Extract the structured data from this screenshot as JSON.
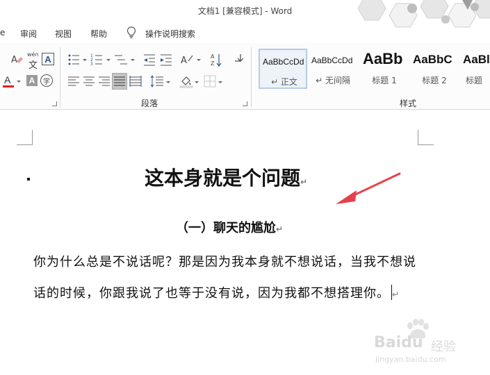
{
  "titlebar": {
    "title": "文档1 [兼容模式]  -  Word"
  },
  "menu": {
    "items": [
      "审阅",
      "视图",
      "帮助"
    ],
    "tell_me": "操作说明搜索"
  },
  "ribbon": {
    "font_group": {
      "phonetic_label": "wén",
      "phonetic_char": "文"
    },
    "paragraph_group": {
      "label": "段落"
    },
    "styles_group": {
      "label": "样式",
      "styles": [
        {
          "sample": "AaBbCcDd",
          "name": "↵ 正文"
        },
        {
          "sample": "AaBbCcDd",
          "name": "↵ 无间隔"
        },
        {
          "sample": "AaBb",
          "name": "标题 1"
        },
        {
          "sample": "AaBbC",
          "name": "标题 2"
        },
        {
          "sample": "AaBl",
          "name": "标题"
        }
      ]
    },
    "colors": {
      "font_color_red": "#e02020",
      "accent_blue": "#2b579a"
    }
  },
  "document": {
    "heading1": "这本身就是个问题",
    "heading2": "（一）聊天的尴尬",
    "paragraph": "你为什么总是不说话呢？那是因为我本身就不想说话，当我不想说话的时候，你跟我说了也等于没有说，因为我都不想搭理你。",
    "paragraph_mark": "↵",
    "arrow_color": "#e8404a"
  },
  "watermark": {
    "brand": "Baidu",
    "brand_cn": "经验",
    "url": "jingyan.baidu.com"
  }
}
